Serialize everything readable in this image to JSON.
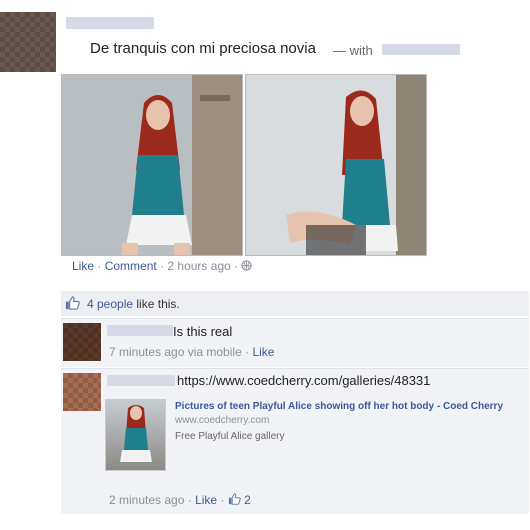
{
  "post": {
    "text": "De tranquis con mi preciosa novia",
    "with_label": "— with",
    "actions": {
      "like": "Like",
      "comment": "Comment",
      "time": "2 hours ago",
      "sep": "·"
    }
  },
  "likes": {
    "count_text": "4 people",
    "suffix": "like this."
  },
  "comments": [
    {
      "text": "Is this real",
      "meta_time": "7 minutes ago via mobile",
      "meta_like": "Like"
    },
    {
      "text": "https://www.coedcherry.com/galleries/48331",
      "share": {
        "title": "Pictures of teen Playful Alice showing off her hot body - Coed Cherry",
        "domain": "www.coedcherry.com",
        "description": "Free Playful Alice gallery"
      },
      "meta_time": "2 minutes ago",
      "meta_like": "Like",
      "like_count": "2"
    }
  ],
  "colors": {
    "link": "#3b5998",
    "muted": "#8a8f99",
    "panel": "#edeff4"
  },
  "icons": {
    "thumbs_up": "thumbs-up-icon",
    "globe": "globe-icon"
  }
}
